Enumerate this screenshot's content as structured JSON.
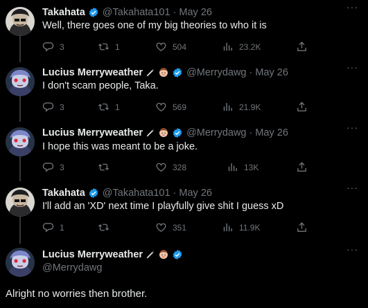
{
  "tweets": [
    {
      "name": "Takahata",
      "handle": "@Takahata101",
      "time": "May 26",
      "text": "Well, there goes one of my big theories to who it is",
      "replies": "3",
      "reposts": "1",
      "likes": "504",
      "views": "23.2K",
      "more": "···"
    },
    {
      "name": "Lucius Merryweather",
      "handle": "@Merrydawg",
      "time": "May 26",
      "text": "I don't scam people, Taka.",
      "replies": "3",
      "reposts": "1",
      "likes": "569",
      "views": "21.9K",
      "more": "···"
    },
    {
      "name": "Lucius Merryweather",
      "handle": "@Merrydawg",
      "time": "May 26",
      "text": "I hope this was meant to be a joke.",
      "replies": "3",
      "reposts": "",
      "likes": "328",
      "views": "13K",
      "more": "···"
    },
    {
      "name": "Takahata",
      "handle": "@Takahata101",
      "time": "May 26",
      "text": "I'll add an 'XD' next time I playfully give shit I guess xD",
      "replies": "1",
      "reposts": "",
      "likes": "351",
      "views": "11.9K",
      "more": "···"
    }
  ],
  "focused": {
    "name": "Lucius Merryweather",
    "handle": "@Merrydawg",
    "text": "Alright no worries then brother.",
    "more": "···"
  },
  "separator": "·",
  "colors": {
    "background": "#000000",
    "text": "#e7e9ea",
    "muted": "#71767b",
    "verified": "#1d9bf0",
    "thread_line": "#333639"
  },
  "icons": [
    "reply-icon",
    "repost-icon",
    "like-icon",
    "views-icon",
    "share-icon",
    "verified-badge-icon",
    "pen-emoji",
    "face-emoji",
    "more-icon"
  ]
}
